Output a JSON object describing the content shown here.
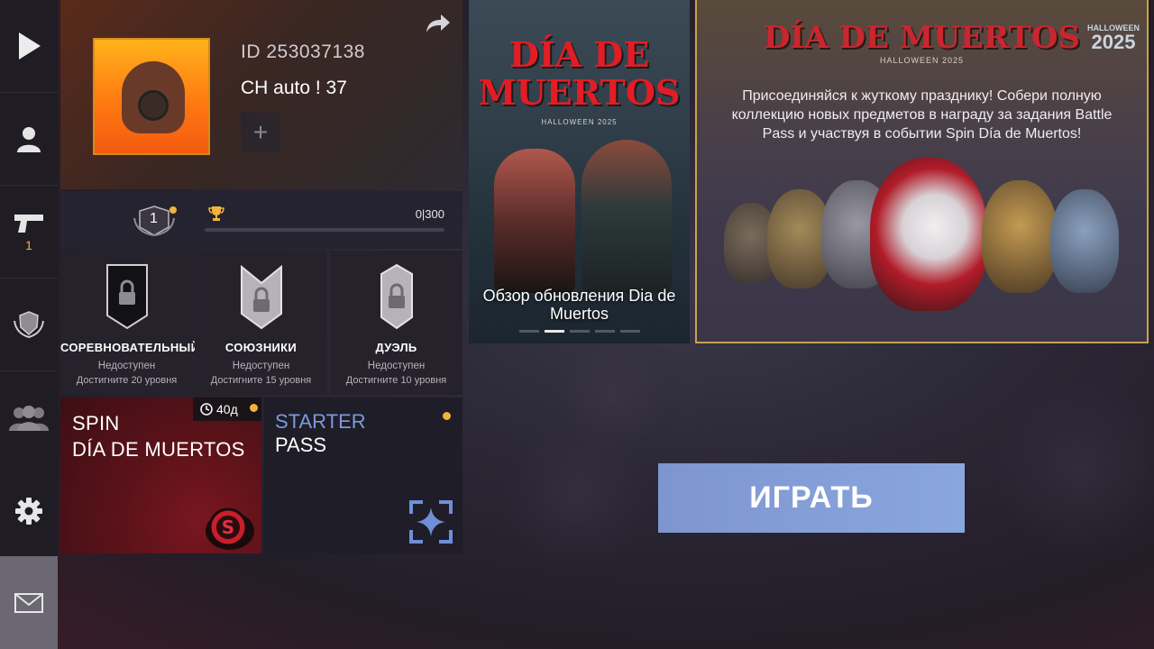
{
  "sidebar": {
    "items": [
      {
        "icon": "play-icon"
      },
      {
        "icon": "profile-icon"
      },
      {
        "icon": "pistol-icon",
        "badge": "1"
      },
      {
        "icon": "rank-emblem-icon"
      },
      {
        "icon": "friends-icon"
      },
      {
        "icon": "settings-gear-icon"
      },
      {
        "icon": "mail-icon"
      }
    ]
  },
  "profile": {
    "id": "ID 253037138",
    "name": "CH auto ! 37",
    "add_label": "+"
  },
  "level": {
    "number": "1",
    "xp_text": "0|300",
    "xp_progress": 0
  },
  "modes": [
    {
      "name": "СОРЕВНОВАТЕЛЬНЫЙ",
      "status": "Недоступен",
      "requirement": "Достигните 20 уровня"
    },
    {
      "name": "СОЮЗНИКИ",
      "status": "Недоступен",
      "requirement": "Достигните 15 уровня"
    },
    {
      "name": "ДУЭЛЬ",
      "status": "Недоступен",
      "requirement": "Достигните 10 уровня"
    }
  ],
  "spin": {
    "title_line1": "SPIN",
    "title_line2": "DÍA DE MUERTOS",
    "timer": "40д"
  },
  "starter": {
    "title": "STARTER",
    "subtitle": "PASS"
  },
  "news": {
    "logo_line1": "DÍA DE",
    "logo_line2": "MUERTOS",
    "logo_sub": "HALLOWEEN 2025",
    "caption": "Обзор обновления Dia de Muertos",
    "carousel_active_index": 1,
    "carousel_count": 5
  },
  "event": {
    "logo": "DÍA DE MUERTOS",
    "logo_sub": "HALLOWEEN 2025",
    "badge_line1": "HALLOWEEN",
    "badge_line2": "2025",
    "text": "Присоединяйся к жуткому празднику! Собери полную коллекцию новых предметов в награду за задания Battle Pass и участвуя в событии Spin Día de Muertos!"
  },
  "play": {
    "label": "ИГРАТЬ"
  },
  "colors": {
    "accent_gold": "#f2b33a",
    "play_blue": "#8aa6de",
    "starter_blue": "#7b9adf",
    "logo_red": "#e21d25"
  }
}
